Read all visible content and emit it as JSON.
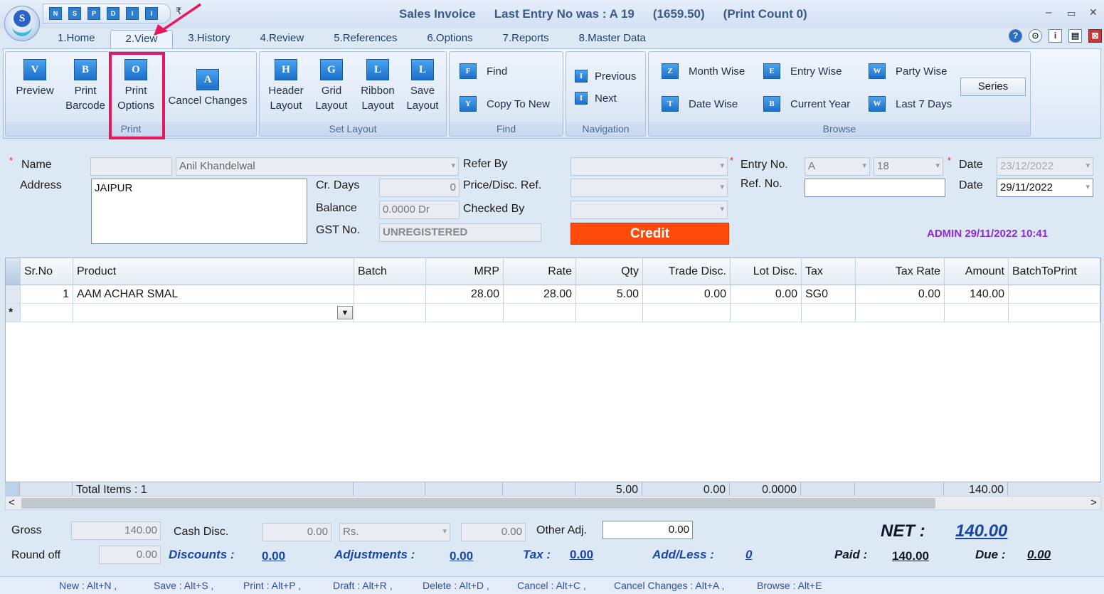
{
  "window": {
    "title": "Sales Invoice",
    "last_entry": "Last Entry No was : A 19",
    "last_amount": "(1659.50)",
    "print_count": "(Print Count 0)",
    "minimize": "–",
    "maximize": "▭",
    "close": "✕",
    "logo_letter": "S"
  },
  "quick_access": {
    "arrow": "₹",
    "items": [
      "N",
      "S",
      "P",
      "D",
      "I",
      "I"
    ]
  },
  "tabs": [
    "1.Home",
    "2.View",
    "3.History",
    "4.Review",
    "5.References",
    "6.Options",
    "7.Reports",
    "8.Master Data"
  ],
  "active_tab": "2.View",
  "help_icons": [
    "?",
    "⊙",
    "i",
    "▤",
    "⊠"
  ],
  "ribbon": {
    "print": {
      "caption": "Print",
      "preview": {
        "icon": "V",
        "l1": "Preview",
        "l2": ""
      },
      "print_barcode": {
        "icon": "B",
        "l1": "Print",
        "l2": "Barcode"
      },
      "print_options": {
        "icon": "O",
        "l1": "Print",
        "l2": "Options"
      },
      "cancel_changes": {
        "icon": "A",
        "l1": "Cancel Changes"
      }
    },
    "set_layout": {
      "caption": "Set Layout",
      "header_layout": {
        "icon": "H",
        "l1": "Header",
        "l2": "Layout"
      },
      "grid_layout": {
        "icon": "G",
        "l1": "Grid",
        "l2": "Layout"
      },
      "ribbon_layout": {
        "icon": "L",
        "l1": "Ribbon",
        "l2": "Layout"
      },
      "save_layout": {
        "icon": "L",
        "l1": "Save",
        "l2": "Layout"
      }
    },
    "find": {
      "caption": "Find",
      "find": {
        "icon": "F",
        "label": "Find"
      },
      "copy_to_new": {
        "icon": "Y",
        "label": "Copy To New"
      }
    },
    "navigation": {
      "caption": "Navigation",
      "previous": {
        "icon": "I",
        "label": "Previous"
      },
      "next": {
        "icon": "I",
        "label": "Next"
      }
    },
    "browse": {
      "caption": "Browse",
      "month_wise": {
        "icon": "Z",
        "label": "Month Wise"
      },
      "date_wise": {
        "icon": "T",
        "label": "Date Wise"
      },
      "entry_wise": {
        "icon": "E",
        "label": "Entry Wise"
      },
      "current_year": {
        "icon": "B",
        "label": "Current Year"
      },
      "party_wise": {
        "icon": "W",
        "label": "Party Wise"
      },
      "last_7_days": {
        "icon": "W",
        "label": "Last 7 Days"
      },
      "series": "Series"
    }
  },
  "form": {
    "name_label": "Name",
    "name_code": "",
    "name_value": "Anil Khandelwal",
    "address_label": "Address",
    "address_value": "JAIPUR",
    "cr_days_label": "Cr. Days",
    "cr_days_value": "0",
    "balance_label": "Balance",
    "balance_value": "0.0000 Dr",
    "gst_label": "GST No.",
    "gst_value": "UNREGISTERED",
    "refer_by_label": "Refer By",
    "price_disc_label": "Price/Disc. Ref.",
    "checked_by_label": "Checked By",
    "credit_button": "Credit",
    "entry_no_label": "Entry No.",
    "entry_series": "A",
    "entry_no": "18",
    "ref_no_label": "Ref. No.",
    "ref_no_value": "",
    "date1_label": "Date",
    "date1_value": "23/12/2022",
    "date2_label": "Date",
    "date2_value": "29/11/2022",
    "admin_stamp": "ADMIN 29/11/2022 10:41"
  },
  "grid": {
    "columns": [
      "Sr.No",
      "Product",
      "Batch",
      "MRP",
      "Rate",
      "Qty",
      "Trade Disc.",
      "Lot Disc.",
      "Tax",
      "Tax Rate",
      "Amount",
      "BatchToPrint"
    ],
    "rows": [
      {
        "sr": "1",
        "product": "AAM ACHAR SMAL",
        "batch": "",
        "mrp": "28.00",
        "rate": "28.00",
        "qty": "5.00",
        "trade_disc": "0.00",
        "lot_disc": "0.00",
        "tax": "SG0",
        "tax_rate": "0.00",
        "amount": "140.00",
        "batch_to_print": ""
      }
    ],
    "new_row_marker": "*",
    "footer": {
      "total_items": "Total Items : 1",
      "qty": "5.00",
      "trade_disc": "0.00",
      "lot_disc": "0.0000",
      "amount": "140.00"
    },
    "scroll_left": "<",
    "scroll_right": ">"
  },
  "totals": {
    "gross_label": "Gross",
    "gross_value": "140.00",
    "cash_disc_label": "Cash Disc.",
    "cash_disc_value": "0.00",
    "cash_disc_type": "Rs.",
    "cash_disc_amount": "0.00",
    "other_adj_label": "Other Adj.",
    "other_adj_value": "0.00",
    "net_label": "NET :",
    "net_value": "140.00",
    "round_off_label": "Round off",
    "round_off_value": "0.00",
    "discounts_label": "Discounts :",
    "discounts_value": "0.00",
    "adjustments_label": "Adjustments :",
    "adjustments_value": "0.00",
    "tax_label": "Tax :",
    "tax_value": "0.00",
    "addless_label": "Add/Less :",
    "addless_value": "0",
    "paid_label": "Paid :",
    "paid_value": "140.00",
    "due_label": "Due :",
    "due_value": "0.00"
  },
  "shortcuts": [
    "New : Alt+N ,",
    "Save : Alt+S ,",
    "Print : Alt+P ,",
    "Draft : Alt+R ,",
    "Delete : Alt+D ,",
    "Cancel : Alt+C ,",
    "Cancel Changes : Alt+A ,",
    "Browse : Alt+E"
  ],
  "colors": {
    "credit": "#ff4a0c",
    "highlight": "#e8175d",
    "admin": "#8a2bd6",
    "totals_blue": "#1846a8"
  }
}
